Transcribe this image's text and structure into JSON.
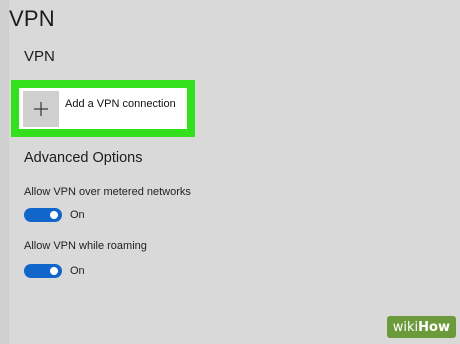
{
  "page": {
    "title": "VPN"
  },
  "vpn_section": {
    "heading": "VPN",
    "add_button_label": "Add a VPN connection",
    "add_icon": "plus-icon",
    "highlight_color": "#33e01b"
  },
  "advanced": {
    "heading": "Advanced Options",
    "settings": [
      {
        "label": "Allow VPN over metered networks",
        "state": "On",
        "enabled": true
      },
      {
        "label": "Allow VPN while roaming",
        "state": "On",
        "enabled": true
      }
    ],
    "toggle_color": "#1166c9"
  },
  "watermark": {
    "part1": "wiki",
    "part2": "How"
  }
}
